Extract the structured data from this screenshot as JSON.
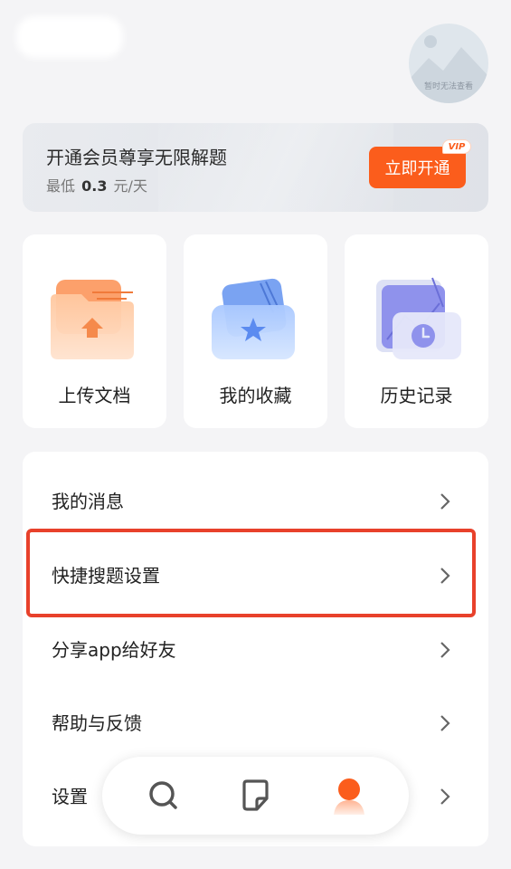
{
  "avatar": {
    "placeholder_text": "暂时无法查看"
  },
  "vip": {
    "title": "开通会员尊享无限解题",
    "price_prefix": "最低",
    "price_value": "0.3",
    "price_unit": "元/天",
    "button_label": "立即开通",
    "tag": "VIP",
    "accent_color": "#fb5d1c"
  },
  "quick_actions": [
    {
      "label": "上传文档",
      "icon": "upload-folder-icon"
    },
    {
      "label": "我的收藏",
      "icon": "favorites-folder-icon"
    },
    {
      "label": "历史记录",
      "icon": "history-clock-icon"
    }
  ],
  "menu": [
    {
      "label": "我的消息"
    },
    {
      "label": "快捷搜题设置"
    },
    {
      "label": "分享app给好友"
    },
    {
      "label": "帮助与反馈"
    },
    {
      "label": "设置"
    }
  ],
  "highlight_color": "#e8412b",
  "bottom_nav": [
    {
      "icon": "search-icon"
    },
    {
      "icon": "note-icon"
    },
    {
      "icon": "profile-icon",
      "active": true
    }
  ]
}
